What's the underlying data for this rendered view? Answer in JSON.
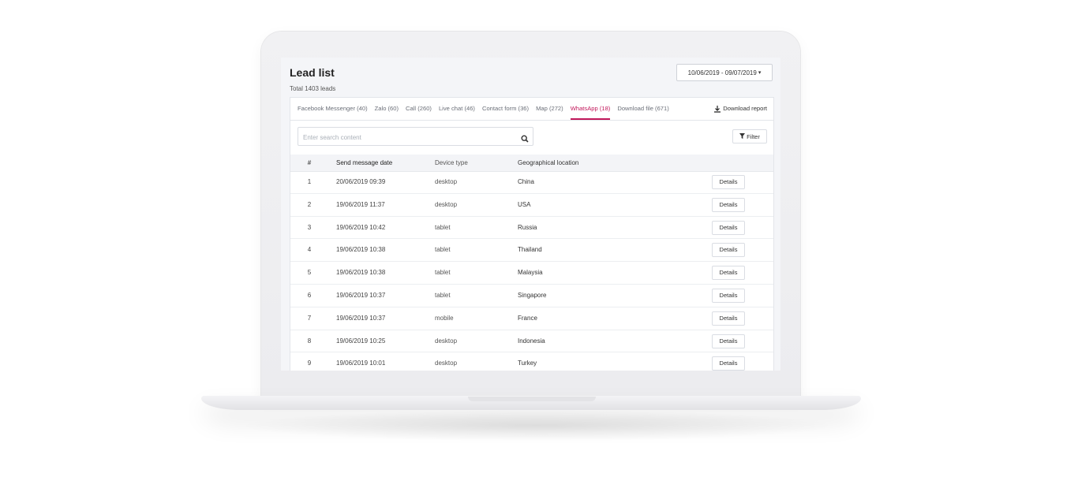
{
  "page": {
    "title": "Lead list",
    "subtitle": "Total 1403 leads",
    "date_range": "10/06/2019 - 09/07/2019"
  },
  "tabs": [
    {
      "label": "Facebook Messenger (40)"
    },
    {
      "label": "Zalo (60)"
    },
    {
      "label": "Call (260)"
    },
    {
      "label": "Live chat (46)"
    },
    {
      "label": "Contact form (36)"
    },
    {
      "label": "Map (272)"
    },
    {
      "label": "WhatsApp (18)",
      "active": true
    },
    {
      "label": "Download file (671)"
    }
  ],
  "download_report": "Download report",
  "search": {
    "placeholder": "Enter search content"
  },
  "filter_label": "Filter",
  "table": {
    "columns": [
      "#",
      "Send message date",
      "Device type",
      "Geographical location"
    ],
    "rows": [
      {
        "num": "1",
        "date": "20/06/2019 09:39",
        "device": "desktop",
        "location": "China",
        "action": "Details"
      },
      {
        "num": "2",
        "date": "19/06/2019 11:37",
        "device": "desktop",
        "location": "USA",
        "action": "Details"
      },
      {
        "num": "3",
        "date": "19/06/2019 10:42",
        "device": "tablet",
        "location": "Russia",
        "action": "Details"
      },
      {
        "num": "4",
        "date": "19/06/2019 10:38",
        "device": "tablet",
        "location": "Thailand",
        "action": "Details"
      },
      {
        "num": "5",
        "date": "19/06/2019 10:38",
        "device": "tablet",
        "location": "Malaysia",
        "action": "Details"
      },
      {
        "num": "6",
        "date": "19/06/2019 10:37",
        "device": "tablet",
        "location": "Singapore",
        "action": "Details"
      },
      {
        "num": "7",
        "date": "19/06/2019 10:37",
        "device": "mobile",
        "location": "France",
        "action": "Details"
      },
      {
        "num": "8",
        "date": "19/06/2019 10:25",
        "device": "desktop",
        "location": "Indonesia",
        "action": "Details"
      },
      {
        "num": "9",
        "date": "19/06/2019 10:01",
        "device": "desktop",
        "location": "Turkey",
        "action": "Details"
      }
    ]
  },
  "colors": {
    "accent": "#c2185b",
    "background": "#f4f5f8"
  }
}
